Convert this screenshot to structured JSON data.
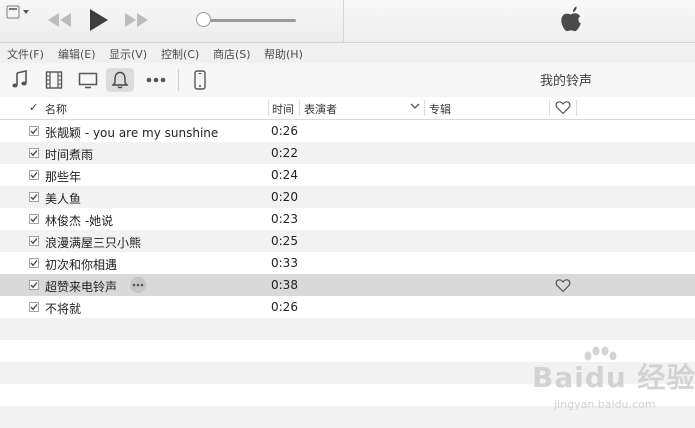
{
  "player": {
    "prev_icon": "rewind-icon",
    "play_icon": "play-icon",
    "next_icon": "fast-forward-icon",
    "volume_level": 0.0,
    "logo_icon": "apple-logo-icon"
  },
  "menu": [
    "文件(F)",
    "编辑(E)",
    "显示(V)",
    "控制(C)",
    "商店(S)",
    "帮助(H)"
  ],
  "toolbar": {
    "icons": [
      "music-note-icon",
      "film-icon",
      "tv-icon",
      "bell-icon",
      "more-icon",
      "iphone-icon"
    ],
    "selected": "bell-icon",
    "title": "我的铃声"
  },
  "columns": {
    "check": "✓",
    "name": "名称",
    "time": "时间",
    "artist": "表演者",
    "album": "专辑",
    "love_icon": "heart-icon"
  },
  "songs": [
    {
      "name": "张靓颖 - you are my sunshine",
      "duration": "0:26",
      "checked": true
    },
    {
      "name": "时间煮雨",
      "duration": "0:22",
      "checked": true
    },
    {
      "name": "那些年",
      "duration": "0:24",
      "checked": true
    },
    {
      "name": "美人鱼",
      "duration": "0:20",
      "checked": true
    },
    {
      "name": "林俊杰 -她说",
      "duration": "0:23",
      "checked": true
    },
    {
      "name": "浪漫满屋三只小熊",
      "duration": "0:25",
      "checked": true
    },
    {
      "name": "初次和你相遇",
      "duration": "0:33",
      "checked": true
    },
    {
      "name": "超赞来电铃声",
      "duration": "0:38",
      "checked": true,
      "selected": true
    },
    {
      "name": "不将就",
      "duration": "0:26",
      "checked": true
    }
  ],
  "watermark": {
    "brand": "Baidu 经验",
    "sub": "jingyan.baidu.com"
  },
  "colors": {
    "selected_row": "#d9d9d9",
    "alt_row": "#f2f2f2"
  }
}
